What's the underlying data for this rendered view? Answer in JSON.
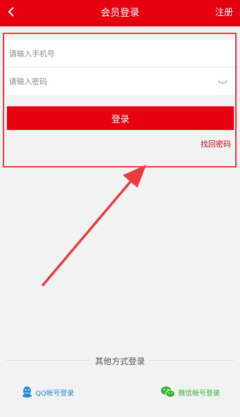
{
  "header": {
    "title": "会员登录",
    "register_label": "注册"
  },
  "form": {
    "phone_placeholder": "请输入手机号",
    "password_placeholder": "请输入密码",
    "login_label": "登录",
    "forgot_label": "找回密码"
  },
  "other": {
    "label": "其他方式登录",
    "qq_label": "QQ帐号登录",
    "wechat_label": "微信帐号登录"
  },
  "colors": {
    "brand": "#e6000f",
    "annotation": "#ec3b3f",
    "qq": "#1a8bd6",
    "wechat": "#3cb035"
  },
  "icons": {
    "back": "chevron-left-icon",
    "eye": "eye-closed-icon",
    "qq": "qq-icon",
    "wechat": "wechat-icon"
  }
}
